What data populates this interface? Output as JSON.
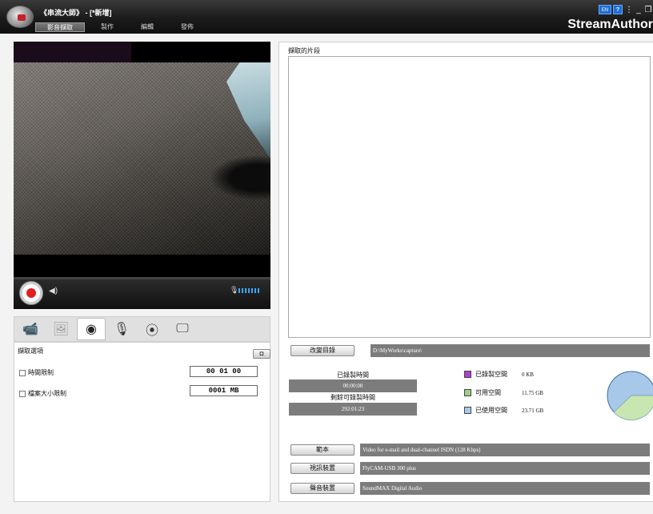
{
  "titlebar": {
    "title": "《串流大師》 - [*新增]",
    "menu": [
      "影音擷取",
      "製作",
      "編輯",
      "發佈"
    ],
    "lang": "EN",
    "help": "?",
    "brand": "StreamAuthor"
  },
  "capture_options": {
    "title": "擷取選項",
    "time_limit_label": "時間限制",
    "time_limit_value": "00 01 00",
    "size_limit_label": "檔案大小限制",
    "size_limit_value": "0001 MB"
  },
  "clips": {
    "title": "擷取的片段"
  },
  "directory": {
    "button": "改變目錄",
    "path": "D:\\MyWorks\\capture\\"
  },
  "stats": {
    "recorded_time_label": "已錄製時間",
    "recorded_time_value": "00:00:00",
    "remaining_time_label": "剩餘可錄製時間",
    "remaining_time_value": "292:01:23"
  },
  "disk": {
    "recorded_space_label": "已錄製空間",
    "recorded_space_value": "0 KB",
    "recorded_space_color": "#b040d0",
    "free_space_label": "可用空間",
    "free_space_value": "11.75 GB",
    "free_space_color": "#9ad08a",
    "used_space_label": "已使用空間",
    "used_space_value": "23.71 GB",
    "used_space_color": "#a8c8ea"
  },
  "settings": {
    "template_button": "範本",
    "template_value": "Video for e-mail and dual-channel ISDN (128 Kbps)",
    "video_device_button": "視訊裝置",
    "video_device_value": "FlyCAM-USB 300 plus",
    "audio_device_button": "聲音裝置",
    "audio_device_value": "SoundMAX Digital Audio"
  },
  "icons": {
    "tabs": [
      "camcorder-icon",
      "photo-frame-icon",
      "webcam-icon",
      "microphone-icon",
      "disc-icon",
      "screen-capture-icon"
    ]
  }
}
